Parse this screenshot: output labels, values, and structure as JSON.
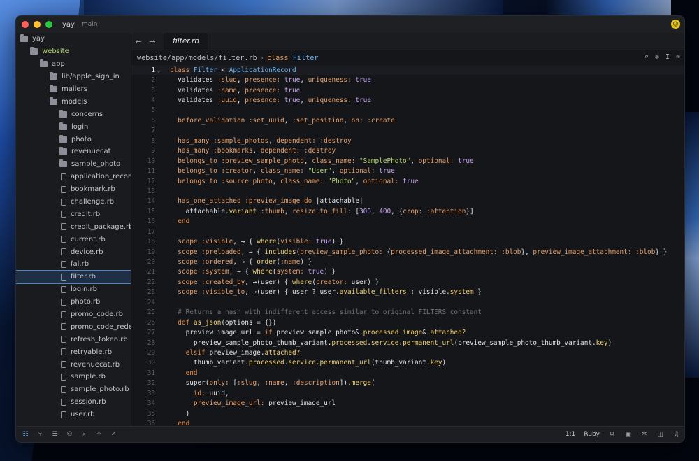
{
  "window": {
    "project": "yay",
    "branch": "main",
    "avatar_glyph": "☺"
  },
  "sidebar": {
    "items": [
      {
        "label": "yay",
        "type": "folder",
        "depth": 0
      },
      {
        "label": "website",
        "type": "folder",
        "depth": 1,
        "active": true
      },
      {
        "label": "app",
        "type": "folder",
        "depth": 2
      },
      {
        "label": "lib/apple_sign_in",
        "type": "folder",
        "depth": 3
      },
      {
        "label": "mailers",
        "type": "folder",
        "depth": 3
      },
      {
        "label": "models",
        "type": "folder",
        "depth": 3
      },
      {
        "label": "concerns",
        "type": "folder",
        "depth": 4
      },
      {
        "label": "login",
        "type": "folder",
        "depth": 4
      },
      {
        "label": "photo",
        "type": "folder",
        "depth": 4
      },
      {
        "label": "revenuecat",
        "type": "folder",
        "depth": 4
      },
      {
        "label": "sample_photo",
        "type": "folder",
        "depth": 4
      },
      {
        "label": "application_record.rb",
        "type": "file",
        "depth": 4
      },
      {
        "label": "bookmark.rb",
        "type": "file",
        "depth": 4
      },
      {
        "label": "challenge.rb",
        "type": "file",
        "depth": 4
      },
      {
        "label": "credit.rb",
        "type": "file",
        "depth": 4
      },
      {
        "label": "credit_package.rb",
        "type": "file",
        "depth": 4
      },
      {
        "label": "current.rb",
        "type": "file",
        "depth": 4
      },
      {
        "label": "device.rb",
        "type": "file",
        "depth": 4
      },
      {
        "label": "fal.rb",
        "type": "file",
        "depth": 4
      },
      {
        "label": "filter.rb",
        "type": "file",
        "depth": 4,
        "selected": true
      },
      {
        "label": "login.rb",
        "type": "file",
        "depth": 4
      },
      {
        "label": "photo.rb",
        "type": "file",
        "depth": 4
      },
      {
        "label": "promo_code.rb",
        "type": "file",
        "depth": 4
      },
      {
        "label": "promo_code_redemption.rb",
        "type": "file",
        "depth": 4
      },
      {
        "label": "refresh_token.rb",
        "type": "file",
        "depth": 4
      },
      {
        "label": "retryable.rb",
        "type": "file",
        "depth": 4
      },
      {
        "label": "revenuecat.rb",
        "type": "file",
        "depth": 4
      },
      {
        "label": "sample.rb",
        "type": "file",
        "depth": 4
      },
      {
        "label": "sample_photo.rb",
        "type": "file",
        "depth": 4
      },
      {
        "label": "session.rb",
        "type": "file",
        "depth": 4
      },
      {
        "label": "user.rb",
        "type": "file",
        "depth": 4
      }
    ]
  },
  "tabs": {
    "back": "←",
    "forward": "→",
    "active_tab": "filter.rb"
  },
  "breadcrumb": {
    "path": "website/app/models/filter.rb",
    "sep": "›",
    "kw": "class",
    "cls": "Filter"
  },
  "crumb_tools": [
    "⌕",
    "✲",
    "I",
    "≈"
  ],
  "code": {
    "lines": [
      [
        [
          "t-kw",
          "class "
        ],
        [
          "t-const",
          "Filter"
        ],
        [
          "t-plain",
          " < "
        ],
        [
          "t-const",
          "ApplicationRecord"
        ]
      ],
      [
        [
          "t-plain",
          "  validates "
        ],
        [
          "t-sym",
          ":slug"
        ],
        [
          "t-plain",
          ", "
        ],
        [
          "t-sym",
          "presence:"
        ],
        [
          "t-plain",
          " "
        ],
        [
          "t-bool",
          "true"
        ],
        [
          "t-plain",
          ", "
        ],
        [
          "t-sym",
          "uniqueness:"
        ],
        [
          "t-plain",
          " "
        ],
        [
          "t-bool",
          "true"
        ]
      ],
      [
        [
          "t-plain",
          "  validates "
        ],
        [
          "t-sym",
          ":name"
        ],
        [
          "t-plain",
          ", "
        ],
        [
          "t-sym",
          "presence:"
        ],
        [
          "t-plain",
          " "
        ],
        [
          "t-bool",
          "true"
        ]
      ],
      [
        [
          "t-plain",
          "  validates "
        ],
        [
          "t-sym",
          ":uuid"
        ],
        [
          "t-plain",
          ", "
        ],
        [
          "t-sym",
          "presence:"
        ],
        [
          "t-plain",
          " "
        ],
        [
          "t-bool",
          "true"
        ],
        [
          "t-plain",
          ", "
        ],
        [
          "t-sym",
          "uniqueness:"
        ],
        [
          "t-plain",
          " "
        ],
        [
          "t-bool",
          "true"
        ]
      ],
      [],
      [
        [
          "t-sym",
          "  before_validation "
        ],
        [
          "t-sym",
          ":set_uuid"
        ],
        [
          "t-plain",
          ", "
        ],
        [
          "t-sym",
          ":set_position"
        ],
        [
          "t-plain",
          ", "
        ],
        [
          "t-sym",
          "on:"
        ],
        [
          "t-plain",
          " "
        ],
        [
          "t-sym",
          ":create"
        ]
      ],
      [],
      [
        [
          "t-sym",
          "  has_many "
        ],
        [
          "t-sym",
          ":sample_photos"
        ],
        [
          "t-plain",
          ", "
        ],
        [
          "t-sym",
          "dependent:"
        ],
        [
          "t-plain",
          " "
        ],
        [
          "t-sym",
          ":destroy"
        ]
      ],
      [
        [
          "t-sym",
          "  has_many "
        ],
        [
          "t-sym",
          ":bookmarks"
        ],
        [
          "t-plain",
          ", "
        ],
        [
          "t-sym",
          "dependent:"
        ],
        [
          "t-plain",
          " "
        ],
        [
          "t-sym",
          ":destroy"
        ]
      ],
      [
        [
          "t-sym",
          "  belongs_to "
        ],
        [
          "t-sym",
          ":preview_sample_photo"
        ],
        [
          "t-plain",
          ", "
        ],
        [
          "t-sym",
          "class_name:"
        ],
        [
          "t-plain",
          " "
        ],
        [
          "t-str",
          "\"SamplePhoto\""
        ],
        [
          "t-plain",
          ", "
        ],
        [
          "t-sym",
          "optional:"
        ],
        [
          "t-plain",
          " "
        ],
        [
          "t-bool",
          "true"
        ]
      ],
      [
        [
          "t-sym",
          "  belongs_to "
        ],
        [
          "t-sym",
          ":creator"
        ],
        [
          "t-plain",
          ", "
        ],
        [
          "t-sym",
          "class_name:"
        ],
        [
          "t-plain",
          " "
        ],
        [
          "t-str",
          "\"User\""
        ],
        [
          "t-plain",
          ", "
        ],
        [
          "t-sym",
          "optional:"
        ],
        [
          "t-plain",
          " "
        ],
        [
          "t-bool",
          "true"
        ]
      ],
      [
        [
          "t-sym",
          "  belongs_to "
        ],
        [
          "t-sym",
          ":source_photo"
        ],
        [
          "t-plain",
          ", "
        ],
        [
          "t-sym",
          "class_name:"
        ],
        [
          "t-plain",
          " "
        ],
        [
          "t-str",
          "\"Photo\""
        ],
        [
          "t-plain",
          ", "
        ],
        [
          "t-sym",
          "optional:"
        ],
        [
          "t-plain",
          " "
        ],
        [
          "t-bool",
          "true"
        ]
      ],
      [],
      [
        [
          "t-sym",
          "  has_one_attached "
        ],
        [
          "t-sym",
          ":preview_image"
        ],
        [
          "t-plain",
          " "
        ],
        [
          "t-kw",
          "do"
        ],
        [
          "t-plain",
          " |attachable|"
        ]
      ],
      [
        [
          "t-plain",
          "    attachable."
        ],
        [
          "t-meth",
          "variant"
        ],
        [
          "t-plain",
          " "
        ],
        [
          "t-sym",
          ":thumb"
        ],
        [
          "t-plain",
          ", "
        ],
        [
          "t-sym",
          "resize_to_fill:"
        ],
        [
          "t-plain",
          " ["
        ],
        [
          "t-num",
          "300"
        ],
        [
          "t-plain",
          ", "
        ],
        [
          "t-num",
          "400"
        ],
        [
          "t-plain",
          ", {"
        ],
        [
          "t-sym",
          "crop:"
        ],
        [
          "t-plain",
          " "
        ],
        [
          "t-sym",
          ":attention"
        ],
        [
          "t-plain",
          "}]"
        ]
      ],
      [
        [
          "t-kw",
          "  end"
        ]
      ],
      [],
      [
        [
          "t-sym",
          "  scope "
        ],
        [
          "t-sym",
          ":visible"
        ],
        [
          "t-plain",
          ", → { "
        ],
        [
          "t-meth",
          "where"
        ],
        [
          "t-plain",
          "("
        ],
        [
          "t-sym",
          "visible:"
        ],
        [
          "t-plain",
          " "
        ],
        [
          "t-bool",
          "true"
        ],
        [
          "t-plain",
          ") }"
        ]
      ],
      [
        [
          "t-sym",
          "  scope "
        ],
        [
          "t-sym",
          ":preloaded"
        ],
        [
          "t-plain",
          ", → { "
        ],
        [
          "t-meth",
          "includes"
        ],
        [
          "t-plain",
          "("
        ],
        [
          "t-sym",
          "preview_sample_photo:"
        ],
        [
          "t-plain",
          " {"
        ],
        [
          "t-sym",
          "processed_image_attachment:"
        ],
        [
          "t-plain",
          " "
        ],
        [
          "t-sym",
          ":blob"
        ],
        [
          "t-plain",
          "}, "
        ],
        [
          "t-sym",
          "preview_image_attachment:"
        ],
        [
          "t-plain",
          " "
        ],
        [
          "t-sym",
          ":blob"
        ],
        [
          "t-plain",
          "} }"
        ]
      ],
      [
        [
          "t-sym",
          "  scope "
        ],
        [
          "t-sym",
          ":ordered"
        ],
        [
          "t-plain",
          ", → { "
        ],
        [
          "t-meth",
          "order"
        ],
        [
          "t-plain",
          "("
        ],
        [
          "t-sym",
          ":name"
        ],
        [
          "t-plain",
          ") }"
        ]
      ],
      [
        [
          "t-sym",
          "  scope "
        ],
        [
          "t-sym",
          ":system"
        ],
        [
          "t-plain",
          ", → { "
        ],
        [
          "t-meth",
          "where"
        ],
        [
          "t-plain",
          "("
        ],
        [
          "t-sym",
          "system:"
        ],
        [
          "t-plain",
          " "
        ],
        [
          "t-bool",
          "true"
        ],
        [
          "t-plain",
          ") }"
        ]
      ],
      [
        [
          "t-sym",
          "  scope "
        ],
        [
          "t-sym",
          ":created_by"
        ],
        [
          "t-plain",
          ", →(user) { "
        ],
        [
          "t-meth",
          "where"
        ],
        [
          "t-plain",
          "("
        ],
        [
          "t-sym",
          "creator:"
        ],
        [
          "t-plain",
          " user) }"
        ]
      ],
      [
        [
          "t-sym",
          "  scope "
        ],
        [
          "t-sym",
          ":visible_to"
        ],
        [
          "t-plain",
          ", →(user) { user ? user."
        ],
        [
          "t-meth",
          "available_filters"
        ],
        [
          "t-plain",
          " : visible."
        ],
        [
          "t-meth",
          "system"
        ],
        [
          "t-plain",
          " }"
        ]
      ],
      [],
      [
        [
          "t-com",
          "  # Returns a hash with indifferent access similar to original FILTERS constant"
        ]
      ],
      [
        [
          "t-kw",
          "  def "
        ],
        [
          "t-meth",
          "as_json"
        ],
        [
          "t-plain",
          "(options = {})"
        ]
      ],
      [
        [
          "t-plain",
          "    preview_image_url = "
        ],
        [
          "t-kw",
          "if"
        ],
        [
          "t-plain",
          " preview_sample_photo&."
        ],
        [
          "t-meth",
          "processed_image"
        ],
        [
          "t-plain",
          "&."
        ],
        [
          "t-meth",
          "attached?"
        ]
      ],
      [
        [
          "t-plain",
          "      preview_sample_photo_thumb_variant."
        ],
        [
          "t-meth",
          "processed"
        ],
        [
          "t-plain",
          "."
        ],
        [
          "t-meth",
          "service"
        ],
        [
          "t-plain",
          "."
        ],
        [
          "t-meth",
          "permanent_url"
        ],
        [
          "t-plain",
          "(preview_sample_photo_thumb_variant."
        ],
        [
          "t-meth",
          "key"
        ],
        [
          "t-plain",
          ")"
        ]
      ],
      [
        [
          "t-kw",
          "    elsif"
        ],
        [
          "t-plain",
          " preview_image."
        ],
        [
          "t-meth",
          "attached?"
        ]
      ],
      [
        [
          "t-plain",
          "      thumb_variant."
        ],
        [
          "t-meth",
          "processed"
        ],
        [
          "t-plain",
          "."
        ],
        [
          "t-meth",
          "service"
        ],
        [
          "t-plain",
          "."
        ],
        [
          "t-meth",
          "permanent_url"
        ],
        [
          "t-plain",
          "(thumb_variant."
        ],
        [
          "t-meth",
          "key"
        ],
        [
          "t-plain",
          ")"
        ]
      ],
      [
        [
          "t-kw",
          "    end"
        ]
      ],
      [
        [
          "t-plain",
          "    super("
        ],
        [
          "t-sym",
          "only:"
        ],
        [
          "t-plain",
          " ["
        ],
        [
          "t-sym",
          ":slug"
        ],
        [
          "t-plain",
          ", "
        ],
        [
          "t-sym",
          ":name"
        ],
        [
          "t-plain",
          ", "
        ],
        [
          "t-sym",
          ":description"
        ],
        [
          "t-plain",
          "])."
        ],
        [
          "t-meth",
          "merge"
        ],
        [
          "t-plain",
          "("
        ]
      ],
      [
        [
          "t-sym",
          "      id:"
        ],
        [
          "t-plain",
          " uuid,"
        ]
      ],
      [
        [
          "t-sym",
          "      preview_image_url:"
        ],
        [
          "t-plain",
          " preview_image_url"
        ]
      ],
      [
        [
          "t-plain",
          "    )"
        ]
      ],
      [
        [
          "t-kw",
          "  end"
        ]
      ]
    ]
  },
  "statusbar": {
    "left_icons": [
      "☷",
      "⑂",
      "☰",
      "⚇",
      "⌕",
      "✧",
      "✓"
    ],
    "cursor": "1:1",
    "language": "Ruby",
    "right_icons": [
      "⚙",
      "▣",
      "✲",
      "◫",
      "♫"
    ]
  }
}
